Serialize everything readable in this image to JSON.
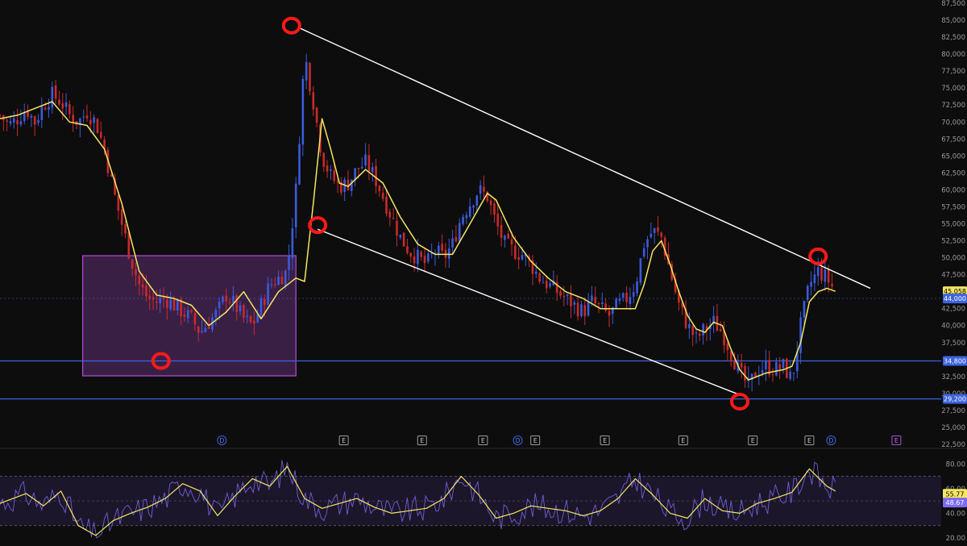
{
  "colors": {
    "background": "#0d0d0d",
    "ma_line": "#f5e663",
    "candle_up": "#3b5bdb",
    "candle_down": "#c92a2a",
    "channel_line": "#ffffff",
    "support_line": "#3d63dd",
    "range_box": "#b04fd6",
    "marker": "#ff1a1a",
    "rsi_line": "#7b6cf0",
    "rsi_ma": "#f5e663",
    "axis_text": "#9a9a9a"
  },
  "chart_data": [
    {
      "type": "candlestick",
      "panel": "price",
      "y_ticks": [
        "87,500",
        "85,000",
        "82,500",
        "80,000",
        "77,500",
        "75,000",
        "72,500",
        "70,000",
        "67,500",
        "65,000",
        "62,500",
        "60,000",
        "57,500",
        "55,000",
        "52,500",
        "50,000",
        "47,500",
        "42,500",
        "40,000",
        "37,500",
        "32,500",
        "30,000",
        "27,500",
        "25,000",
        "22,500"
      ],
      "ylim": [
        22500,
        87500
      ],
      "grid": false,
      "price_badges": [
        {
          "label": "45,058",
          "value": 45058,
          "bg": "#f5e663",
          "fg": "#000000"
        },
        {
          "label": "44,000",
          "value": 44000,
          "bg": "#3d63dd",
          "fg": "#ffffff"
        },
        {
          "label": "34,800",
          "value": 34800,
          "bg": "#3d63dd",
          "fg": "#ffffff"
        },
        {
          "label": "29,200",
          "value": 29200,
          "bg": "#3d63dd",
          "fg": "#ffffff"
        }
      ],
      "horizontal_levels": [
        {
          "value": 34800,
          "style": "solid"
        },
        {
          "value": 29200,
          "style": "solid"
        },
        {
          "value": 44000,
          "style": "dotted"
        }
      ],
      "x_domain": [
        0,
        100
      ],
      "price_path": [
        [
          0,
          71000
        ],
        [
          1,
          69500
        ],
        [
          2,
          70500
        ],
        [
          3,
          72000
        ],
        [
          4,
          70000
        ],
        [
          5,
          72500
        ],
        [
          6,
          74000
        ],
        [
          7,
          73000
        ],
        [
          8,
          71000
        ],
        [
          9,
          70000
        ],
        [
          10,
          71500
        ],
        [
          11,
          70000
        ],
        [
          12,
          66000
        ],
        [
          13,
          60000
        ],
        [
          14,
          55000
        ],
        [
          15,
          50000
        ],
        [
          16,
          46000
        ],
        [
          17,
          44000
        ],
        [
          18,
          43500
        ],
        [
          19,
          44000
        ],
        [
          20,
          43000
        ],
        [
          21,
          42000
        ],
        [
          22,
          41000
        ],
        [
          23,
          39000
        ],
        [
          24,
          40500
        ],
        [
          25,
          42000
        ],
        [
          26,
          44500
        ],
        [
          27,
          43000
        ],
        [
          28,
          41000
        ],
        [
          29,
          40000
        ],
        [
          30,
          43000
        ],
        [
          31,
          46000
        ],
        [
          32,
          47000
        ],
        [
          33,
          48000
        ],
        [
          34,
          60000
        ],
        [
          35,
          80000
        ],
        [
          36,
          73000
        ],
        [
          37,
          65000
        ],
        [
          38,
          62000
        ],
        [
          39,
          60500
        ],
        [
          40,
          61000
        ],
        [
          41,
          63000
        ],
        [
          42,
          64000
        ],
        [
          43,
          62000
        ],
        [
          44,
          59000
        ],
        [
          45,
          56000
        ],
        [
          46,
          53000
        ],
        [
          47,
          51000
        ],
        [
          48,
          50000
        ],
        [
          49,
          49000
        ],
        [
          50,
          51000
        ],
        [
          51,
          50000
        ],
        [
          52,
          52000
        ],
        [
          53,
          56000
        ],
        [
          54,
          58000
        ],
        [
          55,
          60000
        ],
        [
          56,
          59000
        ],
        [
          57,
          55000
        ],
        [
          58,
          52000
        ],
        [
          59,
          51000
        ],
        [
          60,
          50500
        ],
        [
          61,
          49000
        ],
        [
          62,
          47000
        ],
        [
          63,
          46000
        ],
        [
          64,
          45000
        ],
        [
          65,
          44000
        ],
        [
          66,
          43000
        ],
        [
          67,
          42000
        ],
        [
          68,
          43500
        ],
        [
          69,
          42500
        ],
        [
          70,
          41500
        ],
        [
          71,
          43000
        ],
        [
          72,
          44000
        ],
        [
          73,
          46000
        ],
        [
          74,
          52000
        ],
        [
          75,
          54000
        ],
        [
          76,
          53000
        ],
        [
          77,
          48000
        ],
        [
          78,
          43000
        ],
        [
          79,
          40000
        ],
        [
          80,
          38000
        ],
        [
          81,
          39500
        ],
        [
          82,
          40500
        ],
        [
          83,
          39000
        ],
        [
          84,
          36000
        ],
        [
          85,
          33000
        ],
        [
          86,
          31000
        ],
        [
          87,
          33500
        ],
        [
          88,
          34000
        ],
        [
          89,
          33500
        ],
        [
          90,
          34000
        ],
        [
          91,
          32000
        ],
        [
          92,
          40000
        ],
        [
          93,
          46000
        ],
        [
          94,
          48000
        ],
        [
          95,
          47000
        ],
        [
          96,
          45000
        ]
      ],
      "ma_path": [
        [
          0,
          70500
        ],
        [
          2,
          71000
        ],
        [
          4,
          72000
        ],
        [
          6,
          73000
        ],
        [
          8,
          70000
        ],
        [
          10,
          69500
        ],
        [
          12,
          66000
        ],
        [
          14,
          58000
        ],
        [
          16,
          48000
        ],
        [
          18,
          44500
        ],
        [
          20,
          44000
        ],
        [
          22,
          43000
        ],
        [
          24,
          40000
        ],
        [
          26,
          42000
        ],
        [
          28,
          45000
        ],
        [
          30,
          41000
        ],
        [
          32,
          45000
        ],
        [
          34,
          47000
        ],
        [
          35,
          46500
        ],
        [
          36,
          58000
        ],
        [
          37,
          70500
        ],
        [
          38,
          66000
        ],
        [
          39,
          61000
        ],
        [
          40,
          60500
        ],
        [
          42,
          63000
        ],
        [
          44,
          61000
        ],
        [
          46,
          56000
        ],
        [
          48,
          52000
        ],
        [
          50,
          50500
        ],
        [
          52,
          50500
        ],
        [
          54,
          55000
        ],
        [
          56,
          59500
        ],
        [
          57,
          58500
        ],
        [
          59,
          53000
        ],
        [
          61,
          49500
        ],
        [
          63,
          47000
        ],
        [
          65,
          45000
        ],
        [
          67,
          44000
        ],
        [
          69,
          42500
        ],
        [
          71,
          42500
        ],
        [
          73,
          42500
        ],
        [
          74,
          46000
        ],
        [
          75,
          51000
        ],
        [
          76,
          52500
        ],
        [
          77,
          49000
        ],
        [
          78,
          45000
        ],
        [
          79,
          41500
        ],
        [
          80,
          39500
        ],
        [
          81,
          39000
        ],
        [
          82,
          40500
        ],
        [
          83,
          40000
        ],
        [
          84,
          36500
        ],
        [
          85,
          33500
        ],
        [
          86,
          32000
        ],
        [
          88,
          33000
        ],
        [
          90,
          33500
        ],
        [
          91,
          34000
        ],
        [
          92,
          37500
        ],
        [
          93,
          43500
        ],
        [
          94,
          45000
        ],
        [
          95,
          45500
        ],
        [
          96,
          45058
        ]
      ],
      "channel_upper": [
        [
          34.5,
          83800
        ],
        [
          100,
          45500
        ]
      ],
      "channel_lower": [
        [
          36.5,
          54200
        ],
        [
          85,
          29800
        ]
      ],
      "range_box": {
        "x": [
          9.5,
          34
        ],
        "y": [
          32600,
          50300
        ]
      },
      "markers": [
        {
          "x": 33.5,
          "y": 84200
        },
        {
          "x": 36.5,
          "y": 54800
        },
        {
          "x": 18.5,
          "y": 34800
        },
        {
          "x": 85,
          "y": 28800
        },
        {
          "x": 94,
          "y": 50200
        }
      ],
      "events": [
        {
          "x": 25.5,
          "label": "D",
          "kind": "dividend"
        },
        {
          "x": 39.5,
          "label": "E",
          "kind": "earnings"
        },
        {
          "x": 48.5,
          "label": "E",
          "kind": "earnings"
        },
        {
          "x": 55.5,
          "label": "E",
          "kind": "earnings"
        },
        {
          "x": 59.5,
          "label": "D",
          "kind": "dividend"
        },
        {
          "x": 61.5,
          "label": "E",
          "kind": "earnings"
        },
        {
          "x": 69.5,
          "label": "E",
          "kind": "earnings"
        },
        {
          "x": 78.5,
          "label": "E",
          "kind": "earnings"
        },
        {
          "x": 86.5,
          "label": "E",
          "kind": "earnings"
        },
        {
          "x": 93,
          "label": "E",
          "kind": "earnings"
        },
        {
          "x": 95.5,
          "label": "D",
          "kind": "dividend"
        },
        {
          "x": 103,
          "label": "E",
          "kind": "earnings-future"
        }
      ]
    },
    {
      "type": "line",
      "panel": "rsi",
      "y_ticks": [
        "80.00",
        "60.00",
        "40.00",
        "20.00"
      ],
      "ylim": [
        18,
        90
      ],
      "badges": [
        {
          "label": "55.77",
          "value": 55.77,
          "bg": "#f5e663",
          "fg": "#000000"
        },
        {
          "label": "48.67",
          "value": 48.67,
          "bg": "#7b6cf0",
          "fg": "#ffffff"
        }
      ],
      "bands": {
        "upper": 70,
        "middle": 50,
        "lower": 30
      },
      "rsi_ma_path": [
        [
          0,
          48
        ],
        [
          3,
          56
        ],
        [
          5,
          46
        ],
        [
          7,
          58
        ],
        [
          9,
          30
        ],
        [
          11,
          22
        ],
        [
          13,
          34
        ],
        [
          15,
          40
        ],
        [
          17,
          45
        ],
        [
          19,
          52
        ],
        [
          21,
          64
        ],
        [
          23,
          58
        ],
        [
          25,
          38
        ],
        [
          27,
          54
        ],
        [
          29,
          68
        ],
        [
          31,
          62
        ],
        [
          33,
          78
        ],
        [
          35,
          52
        ],
        [
          37,
          44
        ],
        [
          39,
          48
        ],
        [
          41,
          52
        ],
        [
          43,
          45
        ],
        [
          45,
          40
        ],
        [
          47,
          42
        ],
        [
          49,
          44
        ],
        [
          51,
          52
        ],
        [
          53,
          70
        ],
        [
          55,
          55
        ],
        [
          57,
          36
        ],
        [
          59,
          40
        ],
        [
          61,
          46
        ],
        [
          63,
          44
        ],
        [
          65,
          42
        ],
        [
          67,
          38
        ],
        [
          69,
          42
        ],
        [
          71,
          52
        ],
        [
          73,
          68
        ],
        [
          75,
          55
        ],
        [
          77,
          40
        ],
        [
          79,
          36
        ],
        [
          81,
          52
        ],
        [
          83,
          42
        ],
        [
          85,
          40
        ],
        [
          87,
          48
        ],
        [
          89,
          52
        ],
        [
          91,
          57
        ],
        [
          93,
          76
        ],
        [
          95,
          62
        ],
        [
          96,
          58
        ]
      ]
    }
  ]
}
